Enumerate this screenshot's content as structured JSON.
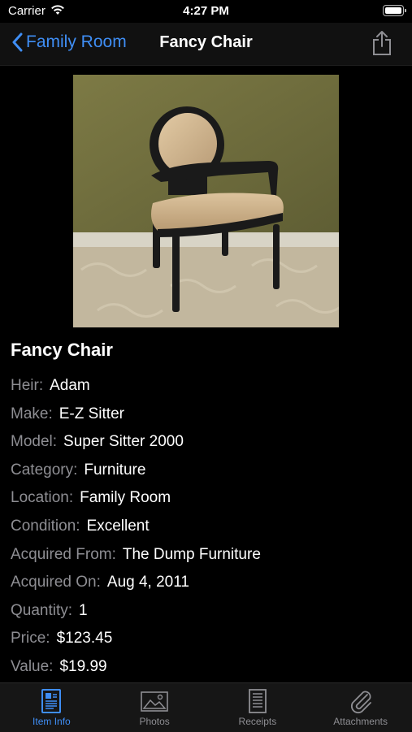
{
  "status_bar": {
    "carrier": "Carrier",
    "time": "4:27 PM"
  },
  "nav": {
    "back_label": "Family Room",
    "title": "Fancy Chair"
  },
  "item": {
    "name": "Fancy Chair",
    "fields": [
      {
        "label": "Heir:",
        "value": "Adam"
      },
      {
        "label": "Make:",
        "value": "E-Z Sitter"
      },
      {
        "label": "Model:",
        "value": "Super Sitter 2000"
      },
      {
        "label": "Category:",
        "value": "Furniture"
      },
      {
        "label": "Location:",
        "value": "Family Room"
      },
      {
        "label": "Condition:",
        "value": "Excellent"
      },
      {
        "label": "Acquired From:",
        "value": "The Dump Furniture"
      },
      {
        "label": "Acquired On:",
        "value": "Aug 4, 2011"
      },
      {
        "label": "Quantity:",
        "value": "1"
      },
      {
        "label": "Price:",
        "value": "$123.45"
      },
      {
        "label": "Value:",
        "value": "$19.99"
      }
    ]
  },
  "tabs": [
    {
      "label": "Item Info",
      "icon": "item-info-icon",
      "active": true
    },
    {
      "label": "Photos",
      "icon": "photos-icon",
      "active": false
    },
    {
      "label": "Receipts",
      "icon": "receipts-icon",
      "active": false
    },
    {
      "label": "Attachments",
      "icon": "paperclip-icon",
      "active": false
    }
  ],
  "colors": {
    "accent": "#3f8ef5",
    "inactive": "#8e8e93",
    "background": "#000000"
  }
}
